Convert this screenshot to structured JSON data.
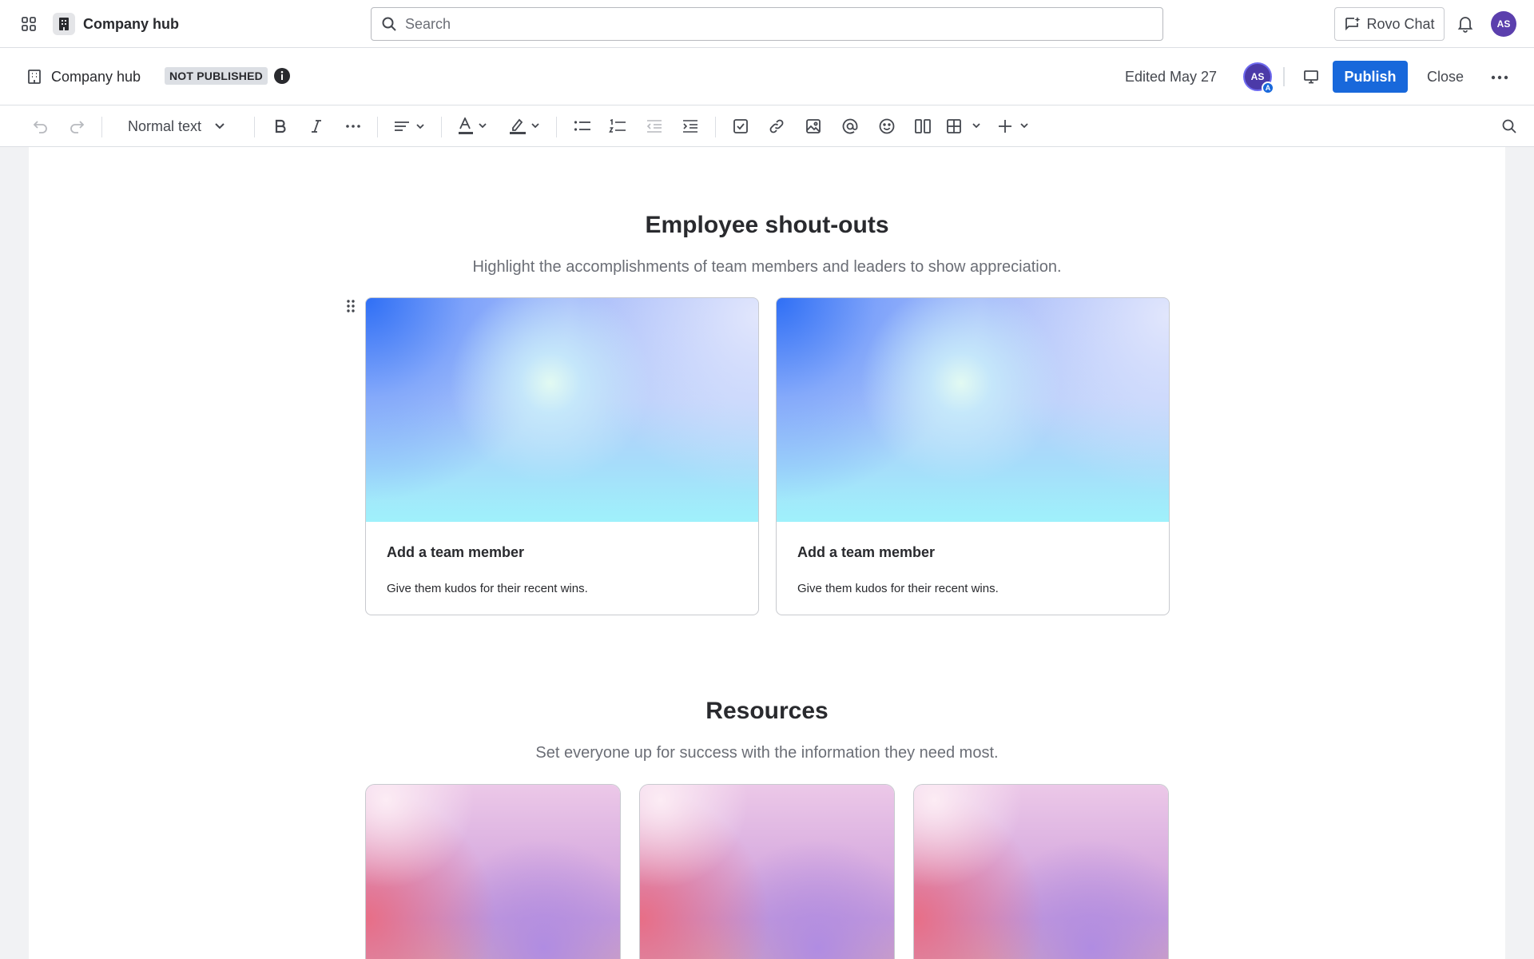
{
  "topnav": {
    "app_name": "Company hub",
    "search_placeholder": "Search",
    "rovo_label": "Rovo Chat",
    "user_initials": "AS"
  },
  "pagebar": {
    "space_name": "Company hub",
    "status": "NOT PUBLISHED",
    "edited": "Edited May 27",
    "collaborator_initials": "AS",
    "collaborator_badge": "A",
    "publish_label": "Publish",
    "close_label": "Close"
  },
  "toolbar": {
    "text_style": "Normal text",
    "icons": [
      "undo-icon",
      "redo-icon",
      "bold-icon",
      "italic-icon",
      "more-formatting-icon",
      "align-icon",
      "text-color-icon",
      "highlight-icon",
      "bullet-list-icon",
      "numbered-list-icon",
      "outdent-icon",
      "indent-icon",
      "task-icon",
      "link-icon",
      "image-icon",
      "mention-icon",
      "emoji-icon",
      "layouts-icon",
      "table-icon",
      "insert-icon",
      "find-icon"
    ]
  },
  "shoutouts": {
    "title": "Employee shout-outs",
    "subtitle": "Highlight the accomplishments of team members and leaders to show appreciation.",
    "cards": [
      {
        "title": "Add a team member",
        "description": "Give them kudos for their recent wins."
      },
      {
        "title": "Add a team member",
        "description": "Give them kudos for their recent wins."
      }
    ]
  },
  "resources": {
    "title": "Resources",
    "subtitle": "Set everyone up for success with the information they need most."
  },
  "colors": {
    "primary": "#1868db",
    "text": "#292a2e",
    "subtle_text": "#6b6e76",
    "border": "#dcdfe4",
    "avatar": "#5b3fad"
  }
}
